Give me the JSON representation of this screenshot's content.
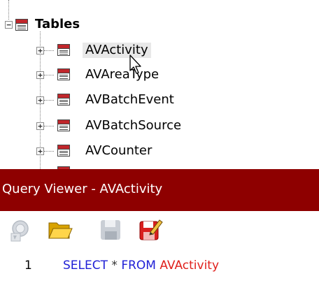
{
  "tree": {
    "root_label": "Tables",
    "items": [
      {
        "label": "AVActivity",
        "selected": true
      },
      {
        "label": "AVAreaType"
      },
      {
        "label": "AVBatchEvent"
      },
      {
        "label": "AVBatchSource"
      },
      {
        "label": "AVCounter"
      }
    ]
  },
  "query_viewer": {
    "title": "Query Viewer - AVActivity",
    "toolbar": [
      "execute-query",
      "open-file",
      "save-file",
      "edit-query"
    ]
  },
  "editor": {
    "line_number": "1",
    "sql": {
      "select": "SELECT",
      "star": "*",
      "from": "FROM",
      "table": "AVActivity"
    }
  },
  "colors": {
    "title_bar": "#8e0000",
    "keyword": "#1f1fd6",
    "identifier": "#e0201c"
  }
}
